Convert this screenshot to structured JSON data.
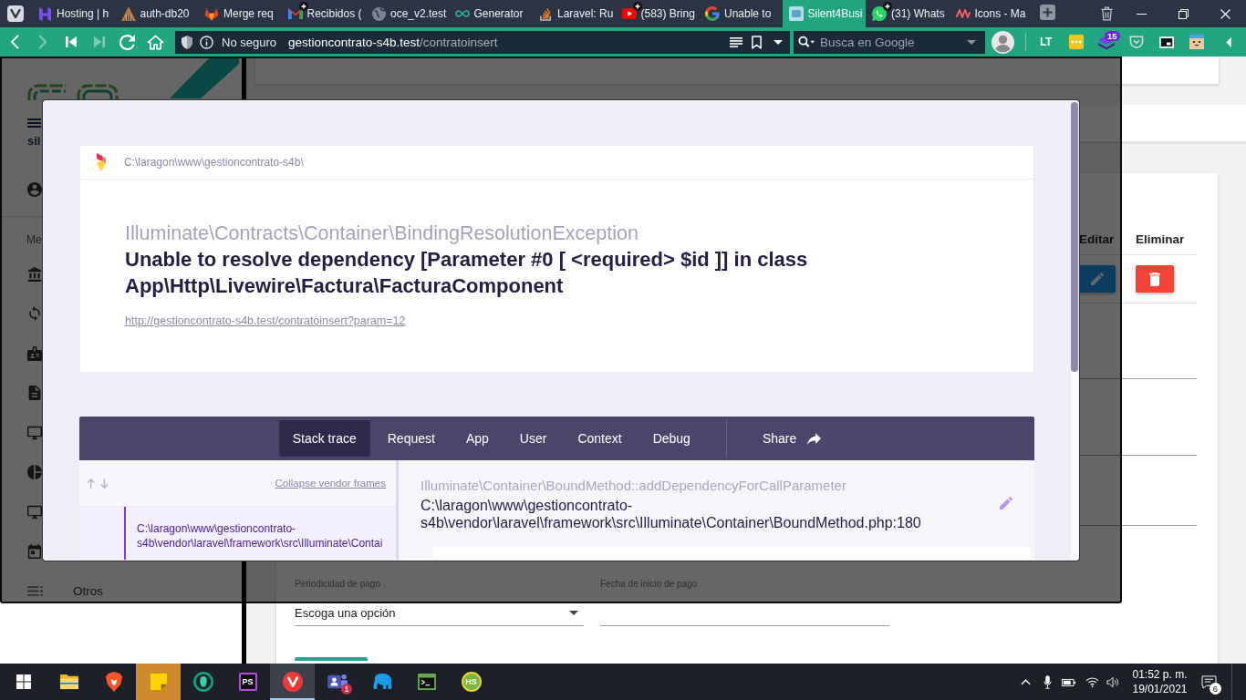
{
  "browser": {
    "tabs": [
      {
        "title": "Hosting | h",
        "kind": "h-mark",
        "badge": false,
        "selected": false
      },
      {
        "title": "auth-db20",
        "kind": "tower",
        "badge": false,
        "selected": false
      },
      {
        "title": "Merge req",
        "kind": "fox-head",
        "badge": false,
        "selected": false
      },
      {
        "title": "Recibidos (",
        "kind": "envelope-m",
        "badge": true,
        "selected": false
      },
      {
        "title": "oce_v2.test",
        "kind": "globe",
        "badge": false,
        "selected": false
      },
      {
        "title": "Generator",
        "kind": "infinity",
        "badge": false,
        "selected": false
      },
      {
        "title": "Laravel: Ru",
        "kind": "tray-stack",
        "badge": false,
        "selected": false
      },
      {
        "title": "(583) Bring",
        "kind": "play",
        "badge": true,
        "selected": false
      },
      {
        "title": "Unable to",
        "kind": "g-letter",
        "badge": false,
        "selected": false
      },
      {
        "title": "Silent4Busi",
        "kind": "square-logo",
        "badge": false,
        "selected": true
      },
      {
        "title": "(31) Whats",
        "kind": "chat-bubble",
        "badge": true,
        "selected": false
      },
      {
        "title": "Icons - Ma",
        "kind": "zigzag",
        "badge": false,
        "selected": false
      }
    ],
    "nav_buttons": [
      {
        "kind": "back",
        "disabled": false
      },
      {
        "kind": "forward",
        "disabled": true
      },
      {
        "kind": "rewind",
        "disabled": false
      },
      {
        "kind": "fast-forward",
        "disabled": true
      },
      {
        "kind": "reload",
        "disabled": false
      },
      {
        "kind": "home",
        "disabled": false
      }
    ],
    "address": {
      "security_label": "No seguro",
      "host": "gestioncontrato-s4b.test",
      "path": "/contratoinsert"
    },
    "search": {
      "placeholder": "Busca en Google"
    },
    "extensions": [
      {
        "kind": "lt",
        "label": "LT"
      },
      {
        "kind": "dots"
      },
      {
        "kind": "layers",
        "count": "15"
      },
      {
        "kind": "pocket"
      },
      {
        "kind": "pip"
      },
      {
        "kind": "face"
      }
    ]
  },
  "site": {
    "sidebar": {
      "brand_text": "sil",
      "section_label": "Me",
      "footer_item": "Otros"
    },
    "table": {
      "columns": [
        "Editar",
        "Eliminar"
      ]
    },
    "form": {
      "fields": [
        {
          "kind": "select",
          "label": "Periodicidad de pago",
          "value": "Escoga una opción"
        },
        {
          "kind": "text",
          "label": "Fecha de inicio de pago"
        }
      ]
    }
  },
  "error_modal": {
    "app_path": "C:\\laragon\\www\\gestioncontrato-s4b\\",
    "exception_class": "Illuminate\\Contracts\\Container\\BindingResolutionException",
    "message": "Unable to resolve dependency [Parameter #0 [ <required> $id ]] in class App\\Http\\Livewire\\Factura\\FacturaComponent",
    "url": "http://gestioncontrato-s4b.test/contratoinsert?param=12",
    "tabs": [
      {
        "label": "Stack trace",
        "selected": true
      },
      {
        "label": "Request",
        "selected": false
      },
      {
        "label": "App",
        "selected": false
      },
      {
        "label": "User",
        "selected": false
      },
      {
        "label": "Context",
        "selected": false
      },
      {
        "label": "Debug",
        "selected": false
      }
    ],
    "share_label": "Share",
    "collapse_link": "Collapse vendor frames",
    "frames": [
      {
        "file": "C:\\laragon\\www\\gestioncontrato-s4b\\vendor\\laravel\\framework\\src\\Illuminate\\Contai",
        "selected": true
      }
    ],
    "current_frame": {
      "method": "Illuminate\\Container\\BoundMethod::addDependencyForCallParameter",
      "file": "C:\\laragon\\www\\gestioncontrato-s4b\\vendor\\laravel\\framework\\src\\Illuminate\\Container\\BoundMethod.php:180"
    }
  },
  "taskbar": {
    "apps": [
      {
        "kind": "folder",
        "selected": false,
        "attention": false
      },
      {
        "kind": "lion-shield",
        "selected": false,
        "attention": false
      },
      {
        "kind": "sticky-note",
        "selected": false,
        "attention": true
      },
      {
        "kind": "ring",
        "selected": false,
        "attention": false
      },
      {
        "kind": "ps",
        "label": "PS",
        "selected": false,
        "attention": false
      },
      {
        "kind": "v-logo",
        "selected": true,
        "attention": false
      },
      {
        "kind": "people",
        "count": "1",
        "selected": false,
        "attention": false
      },
      {
        "kind": "elephant",
        "selected": false,
        "attention": false
      },
      {
        "kind": "terminal",
        "selected": false,
        "attention": false
      },
      {
        "kind": "hs",
        "label": "HS",
        "selected": false,
        "attention": false
      }
    ],
    "time": "01:52 p. m.",
    "date": "19/01/2021",
    "notifications": "6"
  }
}
